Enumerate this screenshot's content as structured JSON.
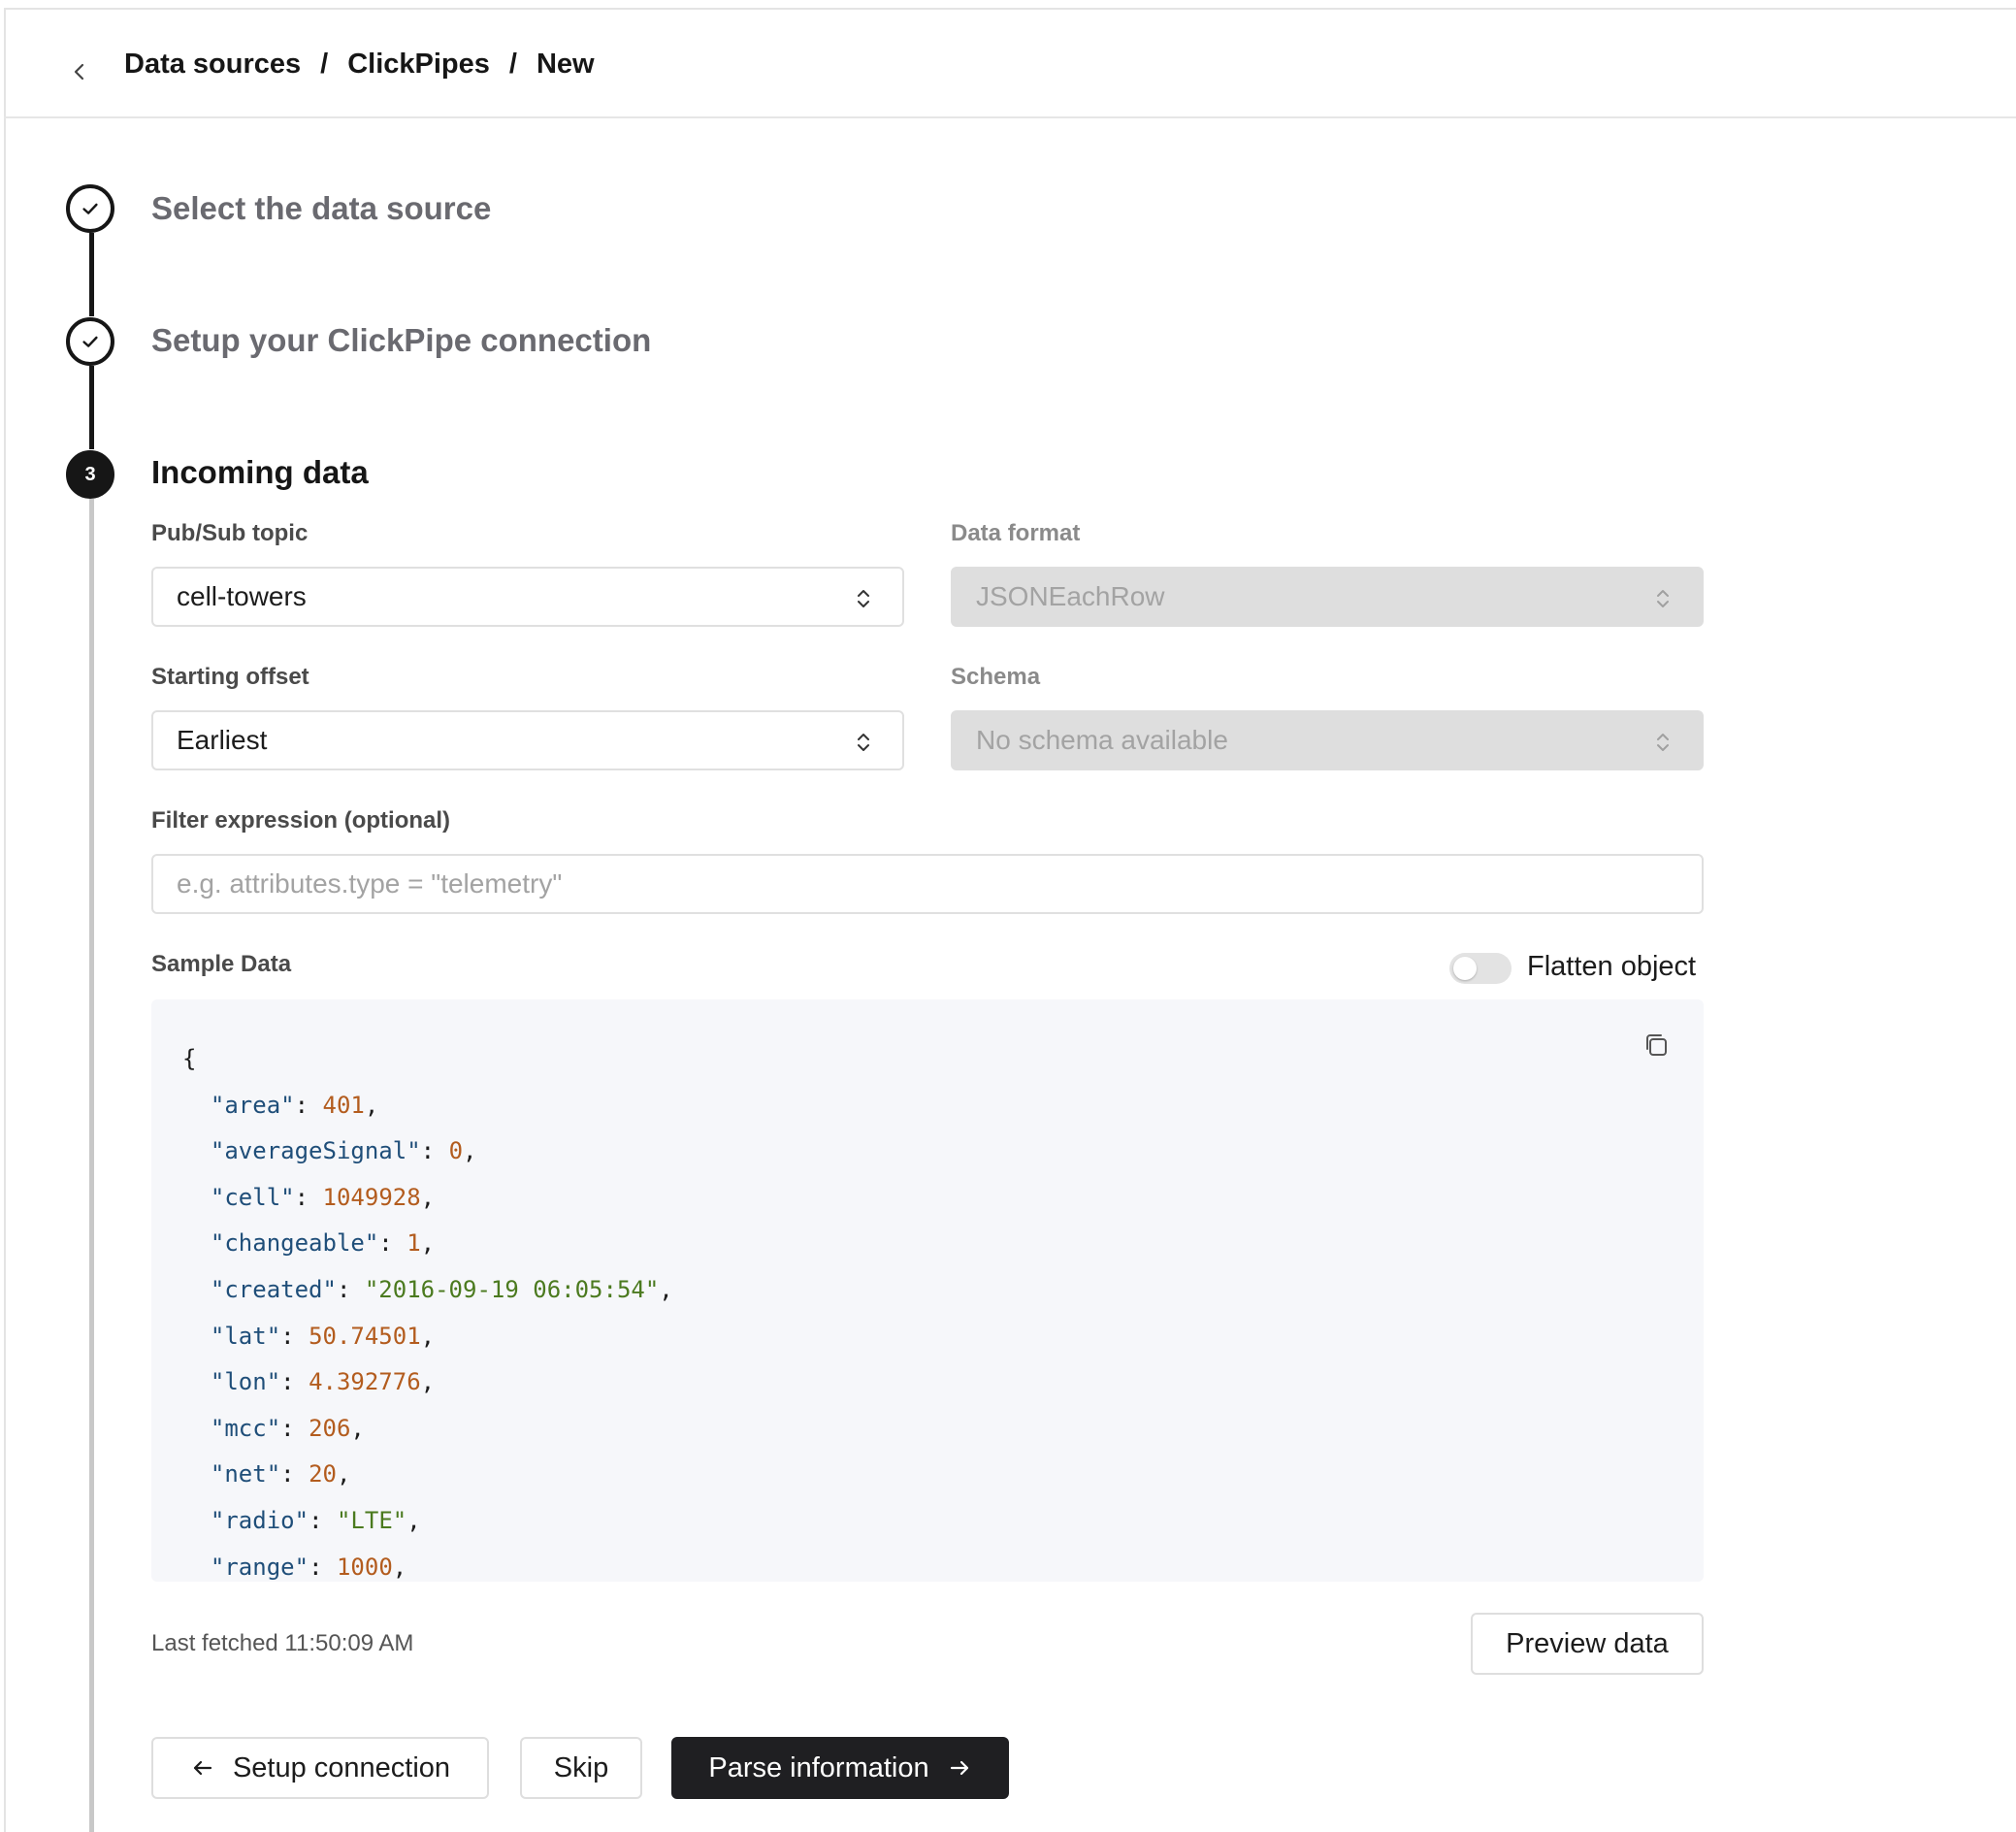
{
  "header": {
    "breadcrumb": [
      "Data sources",
      "ClickPipes",
      "New"
    ],
    "separator": "/"
  },
  "steps": [
    {
      "number": "",
      "title": "Select the data source",
      "status": "complete"
    },
    {
      "number": "",
      "title": "Setup your ClickPipe connection",
      "status": "complete"
    },
    {
      "number": "3",
      "title": "Incoming data",
      "status": "active"
    }
  ],
  "form": {
    "topic": {
      "label": "Pub/Sub topic",
      "value": "cell-towers"
    },
    "format": {
      "label": "Data format",
      "value": "JSONEachRow",
      "disabled": true
    },
    "offset": {
      "label": "Starting offset",
      "value": "Earliest"
    },
    "schema": {
      "label": "Schema",
      "value": "No schema available",
      "disabled": true
    },
    "filter": {
      "label": "Filter expression (optional)",
      "placeholder": "e.g. attributes.type = \"telemetry\"",
      "value": ""
    }
  },
  "sample": {
    "label": "Sample Data",
    "flatten_label": "Flatten object",
    "flatten_on": false,
    "rows": [
      {
        "key": "area",
        "value": "401",
        "kind": "number"
      },
      {
        "key": "averageSignal",
        "value": "0",
        "kind": "number"
      },
      {
        "key": "cell",
        "value": "1049928",
        "kind": "number"
      },
      {
        "key": "changeable",
        "value": "1",
        "kind": "number"
      },
      {
        "key": "created",
        "value": "\"2016-09-19 06:05:54\"",
        "kind": "string"
      },
      {
        "key": "lat",
        "value": "50.74501",
        "kind": "number"
      },
      {
        "key": "lon",
        "value": "4.392776",
        "kind": "number"
      },
      {
        "key": "mcc",
        "value": "206",
        "kind": "number"
      },
      {
        "key": "net",
        "value": "20",
        "kind": "number"
      },
      {
        "key": "radio",
        "value": "\"LTE\"",
        "kind": "string"
      },
      {
        "key": "range",
        "value": "1000",
        "kind": "number"
      }
    ],
    "last_fetched": "Last fetched 11:50:09 AM",
    "preview_label": "Preview data"
  },
  "actions": {
    "back_label": "Setup connection",
    "skip_label": "Skip",
    "next_label": "Parse information"
  },
  "icons": {
    "back": "chevron-left-icon",
    "check": "check-icon",
    "select": "chevron-up-down-icon",
    "copy": "copy-icon",
    "arrow_left": "arrow-left-icon",
    "arrow_right": "arrow-right-icon"
  },
  "colors": {
    "primary": "#1f1f22",
    "code_key": "#1f4e79",
    "code_number": "#b35c1e",
    "code_string": "#4b7a1f",
    "code_bg": "#f6f7fa"
  }
}
